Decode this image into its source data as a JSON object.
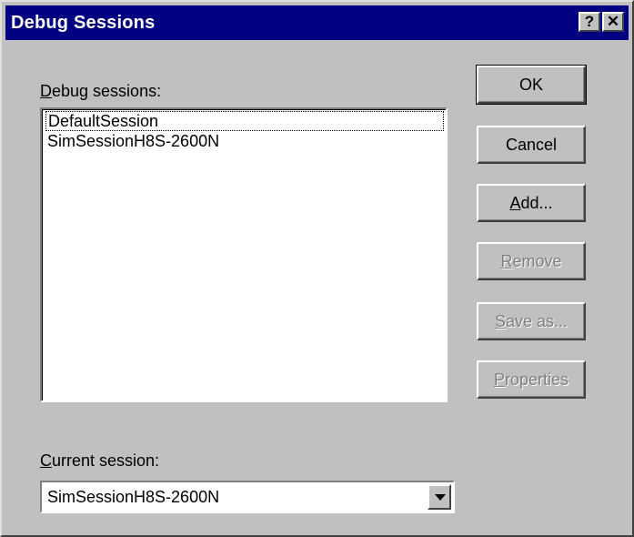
{
  "window": {
    "title": "Debug Sessions",
    "help_label": "?",
    "close_label": "✕"
  },
  "sessions_label": {
    "mnemonic": "D",
    "rest": "ebug sessions:"
  },
  "sessions": [
    "DefaultSession",
    "SimSessionH8S-2600N"
  ],
  "buttons": {
    "ok": "OK",
    "cancel": "Cancel",
    "add": {
      "mnemonic": "A",
      "rest": "dd..."
    },
    "remove": {
      "mnemonic": "R",
      "rest": "emove"
    },
    "save_as": {
      "mnemonic": "S",
      "rest": "ave as..."
    },
    "properties": {
      "mnemonic": "P",
      "rest": "roperties"
    }
  },
  "current_session_label": {
    "mnemonic": "C",
    "rest": "urrent session:"
  },
  "current_session": {
    "value": "SimSessionH8S-2600N"
  },
  "colors": {
    "titlebar": "#000080",
    "face": "#c0c0c0",
    "disabled_text": "#808080"
  }
}
